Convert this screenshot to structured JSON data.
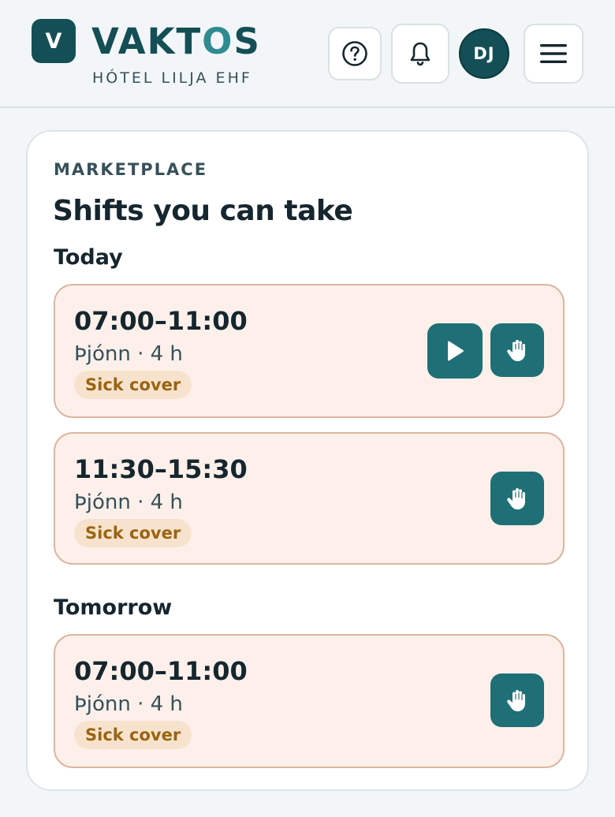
{
  "header": {
    "logo_letter": "V",
    "brand_main": "VAKT",
    "brand_accent": "O",
    "brand_end": "S",
    "subtitle": "HÓTEL LILJA EHF",
    "avatar_initials": "DJ",
    "icons": [
      "help-icon",
      "bell-icon",
      "menu-icon"
    ]
  },
  "marketplace": {
    "eyebrow": "MARKETPLACE",
    "title": "Shifts you can take",
    "groups": [
      {
        "label": "Today",
        "shifts": [
          {
            "time": "07:00–11:00",
            "role": "Þjónn · 4 h",
            "badge": "Sick cover",
            "actions": [
              "play-icon",
              "hand-icon"
            ]
          },
          {
            "time": "11:30–15:30",
            "role": "Þjónn · 4 h",
            "badge": "Sick cover",
            "actions": [
              "hand-icon"
            ]
          }
        ]
      },
      {
        "label": "Tomorrow",
        "shifts": [
          {
            "time": "07:00–11:00",
            "role": "Þjónn · 4 h",
            "badge": "Sick cover",
            "actions": [
              "hand-icon"
            ]
          }
        ]
      }
    ]
  },
  "colors": {
    "brand": "#134f55",
    "accent": "#2f8b90",
    "action": "#1f6f76",
    "shift_bg": "#fdf0ea",
    "badge_text": "#9b6410"
  }
}
